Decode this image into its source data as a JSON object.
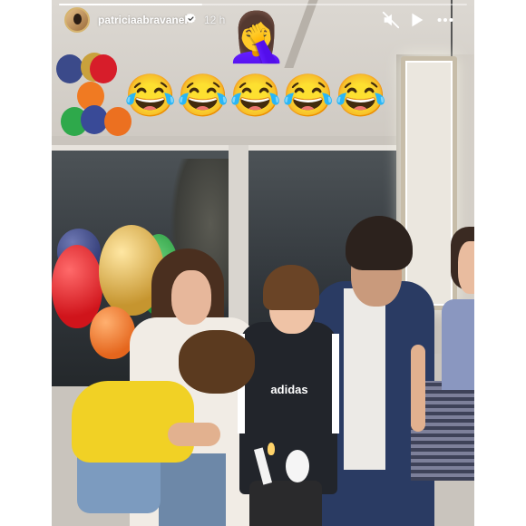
{
  "story": {
    "username": "patriciaabravanel",
    "verified_icon": "verified-badge-icon",
    "timestamp": "12 h",
    "progress": 0.35,
    "controls": [
      "mute-icon",
      "play-icon",
      "more-icon"
    ]
  },
  "stickers": {
    "top": "🤦‍♀️",
    "row": [
      "😂",
      "😂",
      "😂",
      "😂",
      "😂"
    ]
  },
  "photo": {
    "shirt_text": "adidas"
  },
  "colors": {
    "overlay_text": "#ffffff",
    "verified": "#ffffff"
  }
}
